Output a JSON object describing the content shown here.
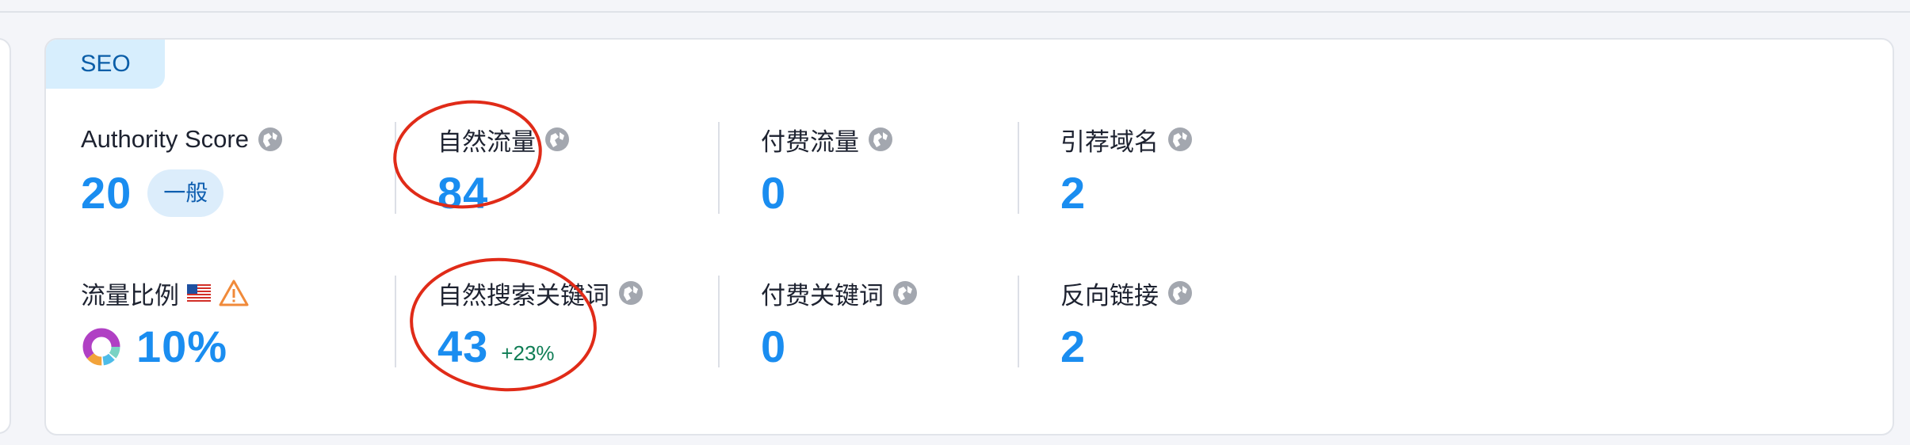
{
  "section": {
    "tag": "SEO"
  },
  "metrics_row1": [
    {
      "label": "Authority Score",
      "value": "20",
      "badge": "一般"
    },
    {
      "label": "自然流量",
      "value": "84"
    },
    {
      "label": "付费流量",
      "value": "0"
    },
    {
      "label": "引荐域名",
      "value": "2"
    }
  ],
  "metrics_row2": [
    {
      "label": "流量比例",
      "value": "10%"
    },
    {
      "label": "自然搜索关键词",
      "value": "43",
      "delta": "+23%"
    },
    {
      "label": "付费关键词",
      "value": "0"
    },
    {
      "label": "反向链接",
      "value": "2"
    }
  ],
  "colors": {
    "value_blue": "#1a8df0",
    "annotation_red": "#e02b18",
    "delta_green": "#0f7d55",
    "badge_bg": "#dcedfb"
  },
  "icons": {
    "info": "globe-question-icon",
    "flag": "us-flag-icon",
    "warning": "warning-triangle-icon",
    "donut": "traffic-share-donut-icon"
  }
}
